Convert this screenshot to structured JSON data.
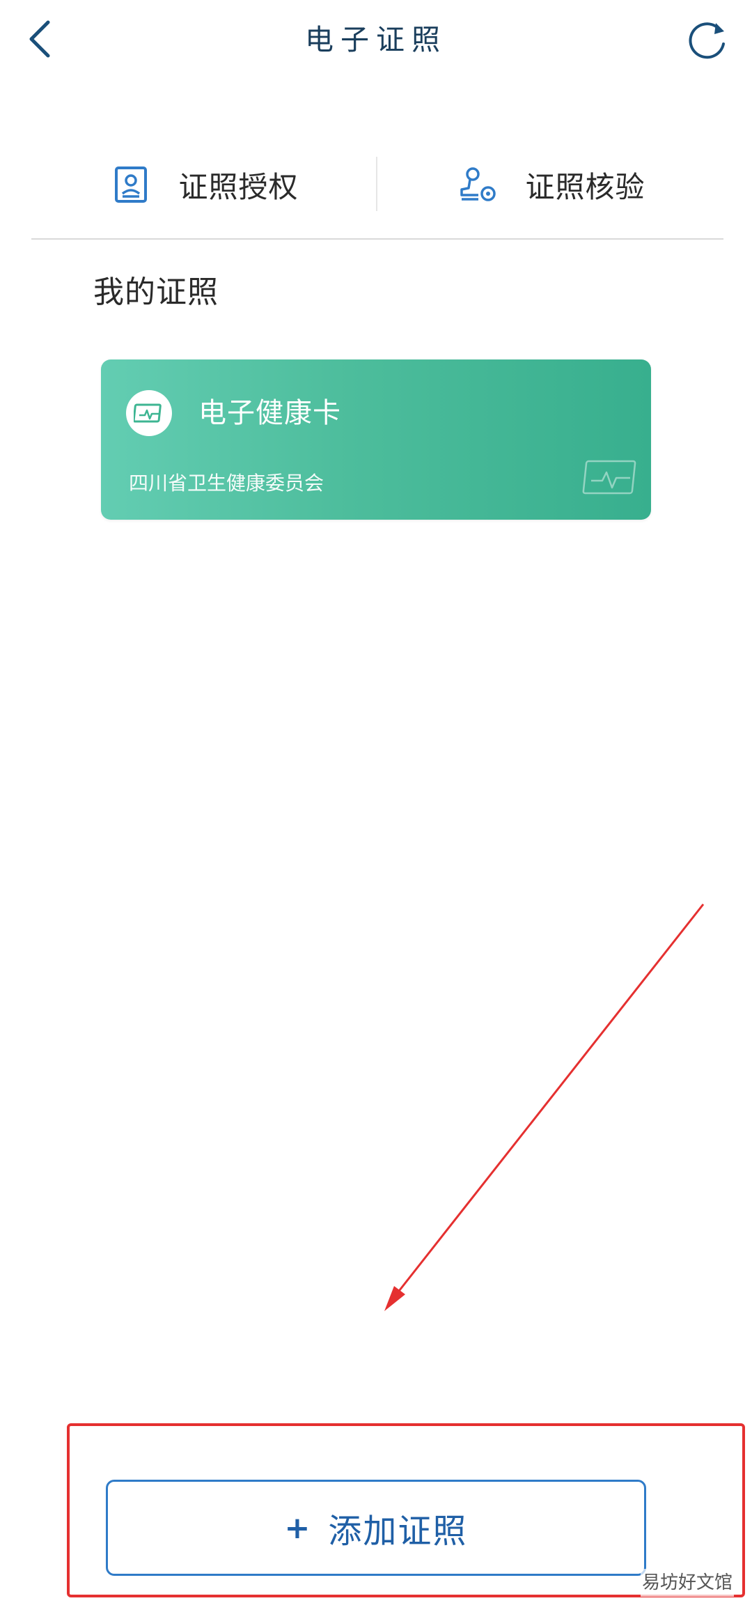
{
  "header": {
    "title": "电子证照",
    "back_icon": "chevron-left-icon",
    "refresh_icon": "refresh-icon"
  },
  "tabs": [
    {
      "label": "证照授权",
      "icon": "id-card-icon"
    },
    {
      "label": "证照核验",
      "icon": "stamp-verify-icon"
    }
  ],
  "section": {
    "title": "我的证照"
  },
  "cards": [
    {
      "name": "电子健康卡",
      "issuer": "四川省卫生健康委员会",
      "logo_icon": "health-card-icon",
      "color_start": "#63cdb2",
      "color_end": "#38af8e"
    }
  ],
  "footer": {
    "add_button_plus": "+",
    "add_button_label": "添加证照"
  },
  "watermark": {
    "text": "易坊好文馆"
  },
  "colors": {
    "primary_blue": "#1f5fa6",
    "title_navy": "#1a3e5c",
    "annotation_red": "#e53030"
  }
}
